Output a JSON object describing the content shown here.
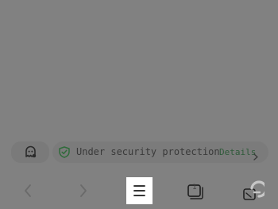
{
  "security": {
    "status_text": "Under security protection",
    "details_label": "Details"
  },
  "tabs": {
    "count": "1"
  },
  "profile": {
    "letter": "G"
  },
  "icons": {
    "ghost": "incognito-ghost-icon",
    "shield": "shield-check-icon",
    "back": "chevron-left-icon",
    "forward": "chevron-right-icon",
    "menu": "hamburger-menu-icon",
    "tabs": "tabs-icon",
    "profile": "profile-icon"
  },
  "colors": {
    "overlay": "#818181",
    "shield_accent": "#2f6b3a",
    "details_accent": "#2f5a3a"
  }
}
